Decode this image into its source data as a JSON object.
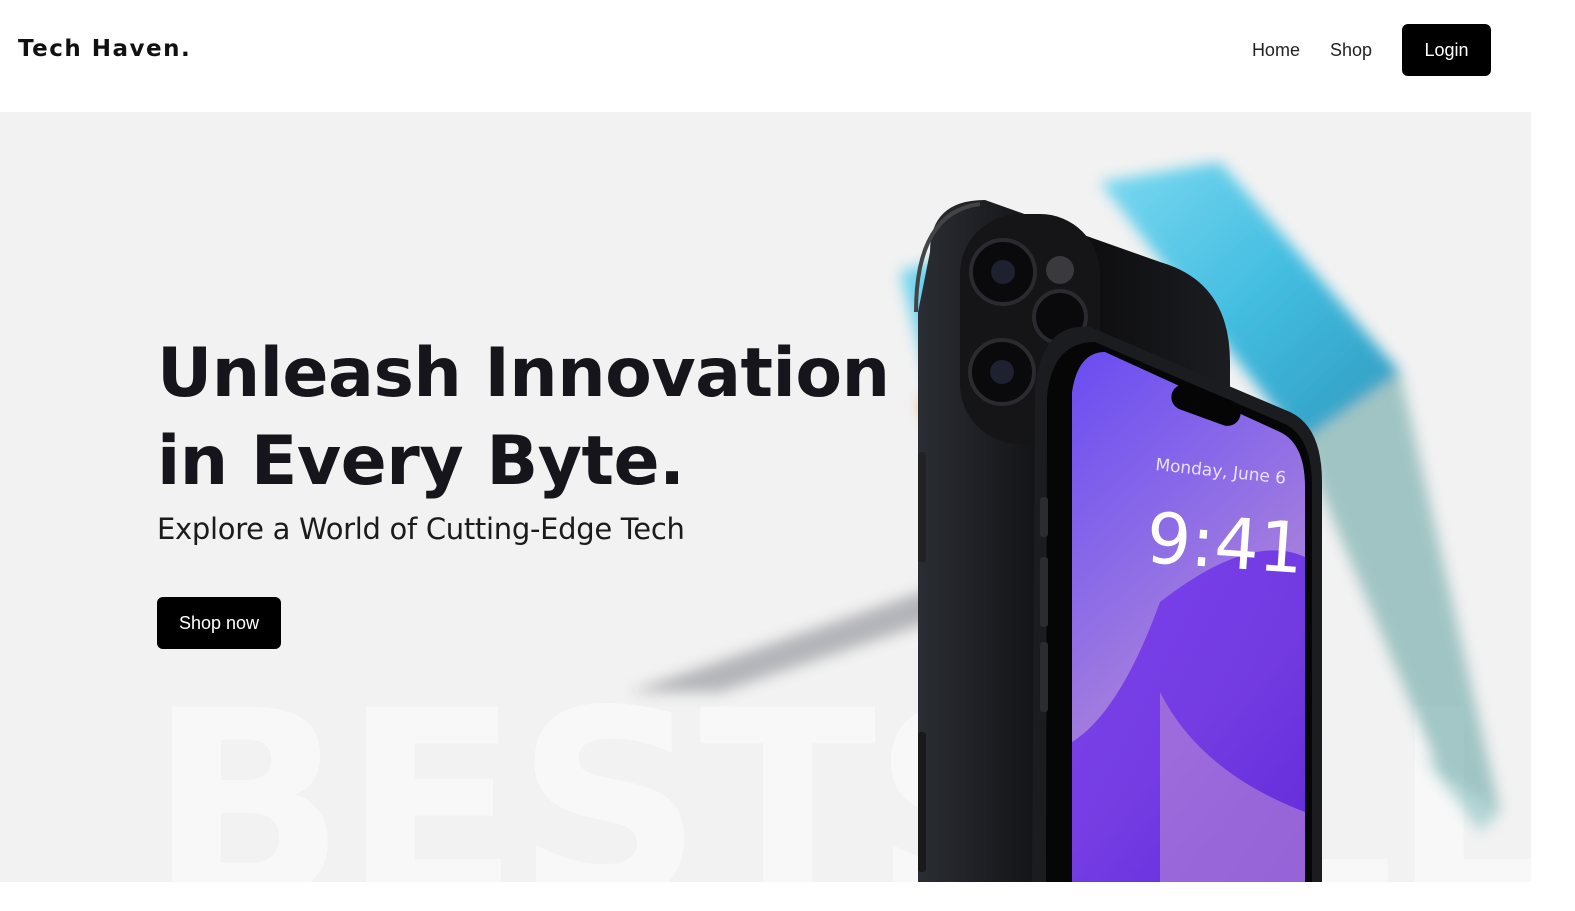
{
  "header": {
    "logo": "Tech Haven.",
    "nav": [
      {
        "label": "Home"
      },
      {
        "label": "Shop"
      }
    ],
    "login_label": "Login"
  },
  "hero": {
    "title_line1": "Unleash Innovation",
    "title_line2": "in Every Byte.",
    "subtitle": "Explore a World of Cutting-Edge Tech",
    "cta_label": "Shop now",
    "background_word": "BESTSELLER",
    "phone_date": "Monday, June 6",
    "phone_time": "9:41"
  },
  "colors": {
    "hero_bg": "#f2f2f2",
    "button_bg": "#000000",
    "text_dark": "#15151b",
    "phone_screen": "#7b5cf0",
    "laptop_screen": "#3ec6e6"
  },
  "icons": [
    "phone-image",
    "laptop-image"
  ]
}
